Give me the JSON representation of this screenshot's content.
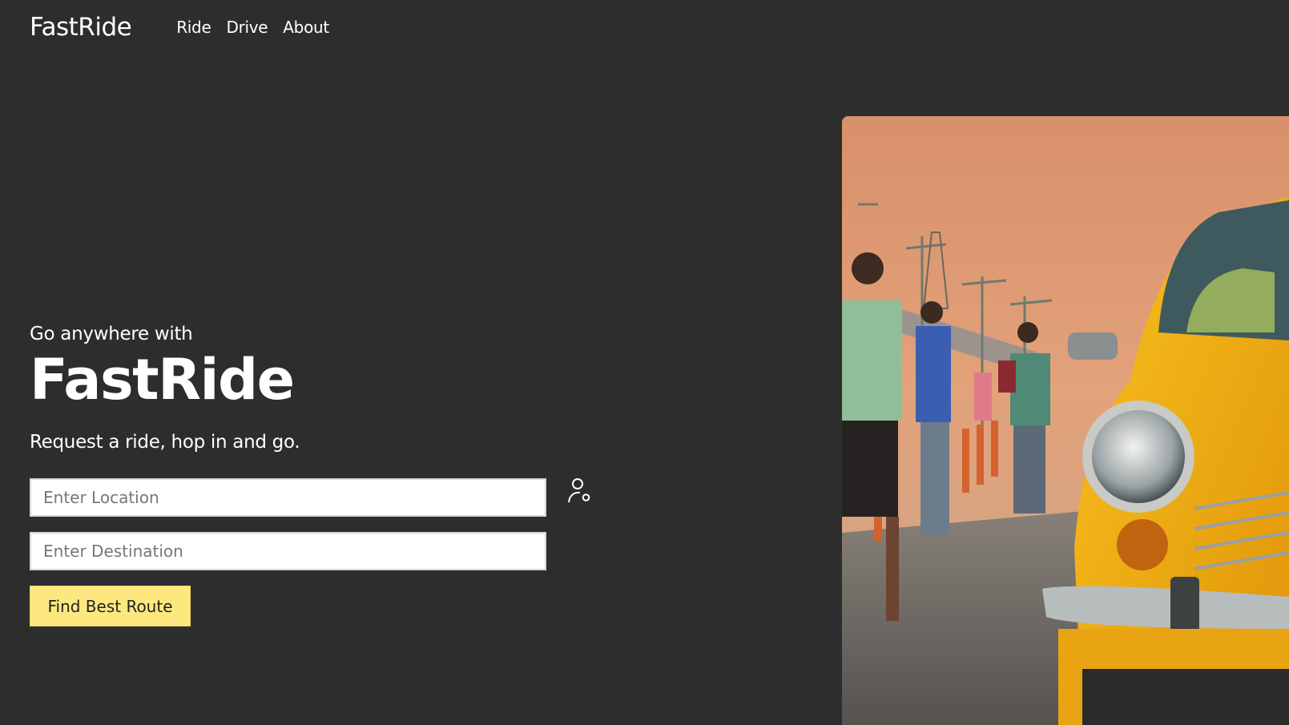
{
  "nav": {
    "brand": "FastRide",
    "links": [
      {
        "label": "Ride"
      },
      {
        "label": "Drive"
      },
      {
        "label": "About"
      }
    ]
  },
  "hero": {
    "eyebrow": "Go anywhere with",
    "title": "FastRide",
    "tagline": "Request a ride, hop in and go."
  },
  "form": {
    "location_placeholder": "Enter Location",
    "destination_placeholder": "Enter Destination",
    "location_icon": "person-pin-icon",
    "submit_label": "Find Best Route"
  },
  "image": {
    "subject": "yellow-taxi-street-photo"
  },
  "colors": {
    "background": "#2d2d2d",
    "text": "#ffffff",
    "cta": "#fde87f",
    "taxi": "#f5a80d"
  }
}
